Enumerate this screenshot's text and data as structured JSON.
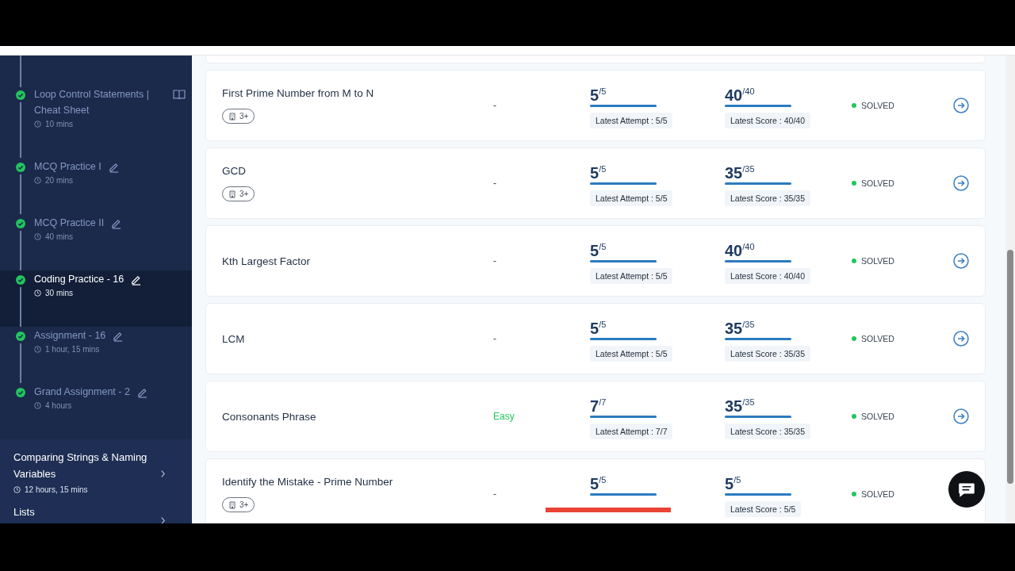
{
  "sidebar": {
    "steps": [
      {
        "title": "Loop Control Statements | Cheat Sheet",
        "duration": "10 mins",
        "kind": "reading",
        "completed": true,
        "selected": false
      },
      {
        "title": "MCQ Practice I",
        "duration": "20 mins",
        "kind": "practice",
        "completed": true,
        "selected": false
      },
      {
        "title": "MCQ Practice II",
        "duration": "40 mins",
        "kind": "practice",
        "completed": true,
        "selected": false
      },
      {
        "title": "Coding Practice - 16",
        "duration": "30 mins",
        "kind": "practice",
        "completed": true,
        "selected": true
      },
      {
        "title": "Assignment - 16",
        "duration": "1 hour, 15 mins",
        "kind": "practice",
        "completed": true,
        "selected": false
      },
      {
        "title": "Grand Assignment - 2",
        "duration": "4 hours",
        "kind": "practice",
        "completed": true,
        "selected": false
      }
    ],
    "sections": [
      {
        "title": "Comparing Strings & Naming Variables",
        "duration": "12 hours, 15 mins"
      },
      {
        "title": "Lists"
      }
    ]
  },
  "questions": [
    {
      "title": "First Prime Number from M to N",
      "tag": "3+",
      "difficulty": {
        "text": "-",
        "kind": "none"
      },
      "attempts": {
        "value": "5",
        "total": "/5",
        "level": 1,
        "latest": "Latest Attempt : 5/5"
      },
      "score": {
        "value": "40",
        "total": "/40",
        "level": 1,
        "latest": "Latest Score : 40/40"
      },
      "status": {
        "text": "SOLVED",
        "color": "#22c55e"
      }
    },
    {
      "title": "GCD",
      "tag": "3+",
      "difficulty": {
        "text": "-",
        "kind": "none"
      },
      "attempts": {
        "value": "5",
        "total": "/5",
        "level": 1,
        "latest": "Latest Attempt : 5/5"
      },
      "score": {
        "value": "35",
        "total": "/35",
        "level": 1,
        "latest": "Latest Score : 35/35"
      },
      "status": {
        "text": "SOLVED",
        "color": "#22c55e"
      }
    },
    {
      "title": "Kth Largest Factor",
      "difficulty": {
        "text": "-",
        "kind": "none"
      },
      "attempts": {
        "value": "5",
        "total": "/5",
        "level": 1,
        "latest": "Latest Attempt : 5/5"
      },
      "score": {
        "value": "40",
        "total": "/40",
        "level": 1,
        "latest": "Latest Score : 40/40"
      },
      "status": {
        "text": "SOLVED",
        "color": "#22c55e"
      }
    },
    {
      "title": "LCM",
      "difficulty": {
        "text": "-",
        "kind": "none"
      },
      "attempts": {
        "value": "5",
        "total": "/5",
        "level": 1,
        "latest": "Latest Attempt : 5/5"
      },
      "score": {
        "value": "35",
        "total": "/35",
        "level": 1,
        "latest": "Latest Score : 35/35"
      },
      "status": {
        "text": "SOLVED",
        "color": "#22c55e"
      }
    },
    {
      "title": "Consonants Phrase",
      "difficulty": {
        "text": "Easy",
        "kind": "easy"
      },
      "attempts": {
        "value": "7",
        "total": "/7",
        "level": 1,
        "latest": "Latest Attempt : 7/7"
      },
      "score": {
        "value": "35",
        "total": "/35",
        "level": 1,
        "latest": "Latest Score : 35/35"
      },
      "status": {
        "text": "SOLVED",
        "color": "#22c55e"
      }
    },
    {
      "title": "Identify the Mistake - Prime Number",
      "tag": "3+",
      "difficulty": {
        "text": "-",
        "kind": "none"
      },
      "attempts": {
        "value": "5",
        "total": "/5",
        "level": 1
      },
      "score": {
        "value": "5",
        "total": "/5",
        "level": 1,
        "latest": "Latest Score : 5/5"
      },
      "status": {
        "text": "SOLVED",
        "color": "#22c55e"
      }
    }
  ]
}
